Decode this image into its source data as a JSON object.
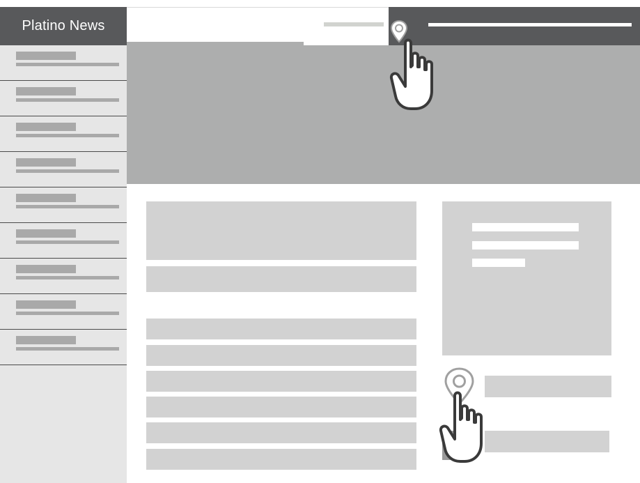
{
  "app": {
    "brand": "Platino News"
  },
  "colors": {
    "header_dark": "#58595b",
    "sidebar_bg": "#e6e6e6",
    "hero_bg": "#adaeae",
    "placeholder": "#d2d2d2"
  },
  "icons": {
    "location_pin_top": "location-pin-icon",
    "location_pin_bottom": "location-pin-icon",
    "hand_pointer": "hand-pointer-icon"
  },
  "sidebar": {
    "items": [
      {
        "id": "item-1"
      },
      {
        "id": "item-2"
      },
      {
        "id": "item-3"
      },
      {
        "id": "item-4"
      },
      {
        "id": "item-5"
      },
      {
        "id": "item-6"
      },
      {
        "id": "item-7"
      },
      {
        "id": "item-8"
      },
      {
        "id": "item-9"
      }
    ]
  },
  "main": {
    "list_rows": [
      {
        "id": "row-1"
      },
      {
        "id": "row-2"
      },
      {
        "id": "row-3"
      },
      {
        "id": "row-4"
      },
      {
        "id": "row-5"
      },
      {
        "id": "row-6"
      }
    ]
  }
}
